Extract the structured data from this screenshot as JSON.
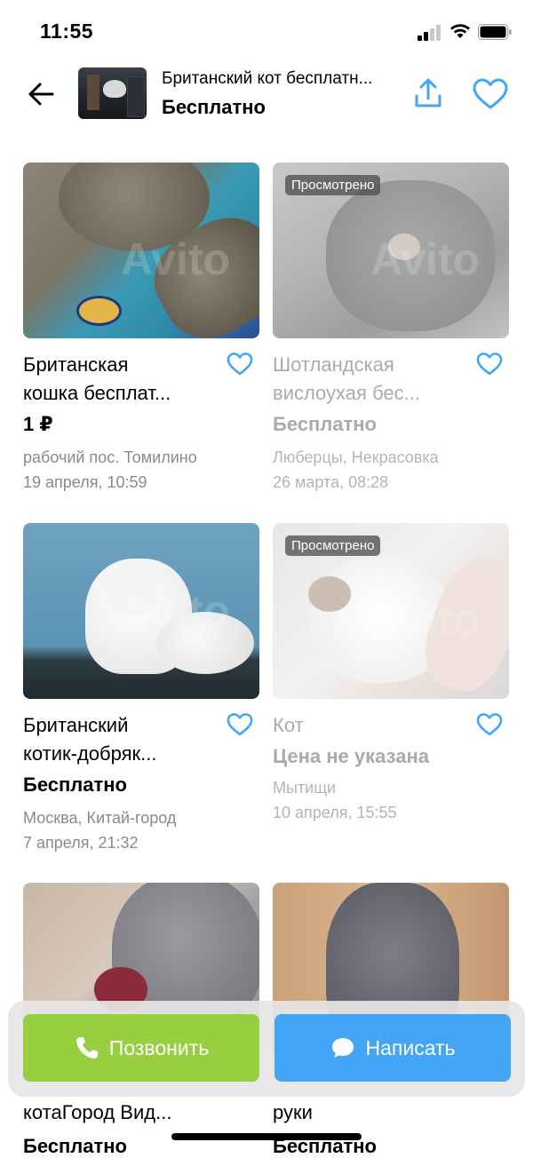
{
  "status_bar": {
    "time": "11:55"
  },
  "header": {
    "title": "Британский кот бесплатн...",
    "price": "Бесплатно"
  },
  "accent_color": "#42a5f5",
  "call_color": "#97cf40",
  "listings": [
    {
      "title_line1": "Британская",
      "title_line2": "кошка бесплат...",
      "price": "1 ₽",
      "location": "рабочий пос. Томилино",
      "date": "19 апреля, 10:59",
      "badge": "",
      "viewed": false
    },
    {
      "title_line1": "Шотландская",
      "title_line2": "вислоухая бес...",
      "price": "Бесплатно",
      "location": "Люберцы, Некрасовка",
      "date": "26 марта, 08:28",
      "badge": "Просмотрено",
      "viewed": true
    },
    {
      "title_line1": "Британский",
      "title_line2": "котик-добряк...",
      "price": "Бесплатно",
      "location": "Москва, Китай-город",
      "date": "7 апреля, 21:32",
      "badge": "",
      "viewed": false
    },
    {
      "title_line1": "Кот",
      "title_line2": "",
      "price": "Цена не указана",
      "location": "Мытищи",
      "date": "10 апреля, 15:55",
      "badge": "Просмотрено",
      "viewed": true
    }
  ],
  "peek_row": {
    "left_title": "котаГород Вид...",
    "left_price": "Бесплатно",
    "right_title": "руки",
    "right_price": "Бесплатно"
  },
  "actions": {
    "call_label": "Позвонить",
    "message_label": "Написать"
  }
}
